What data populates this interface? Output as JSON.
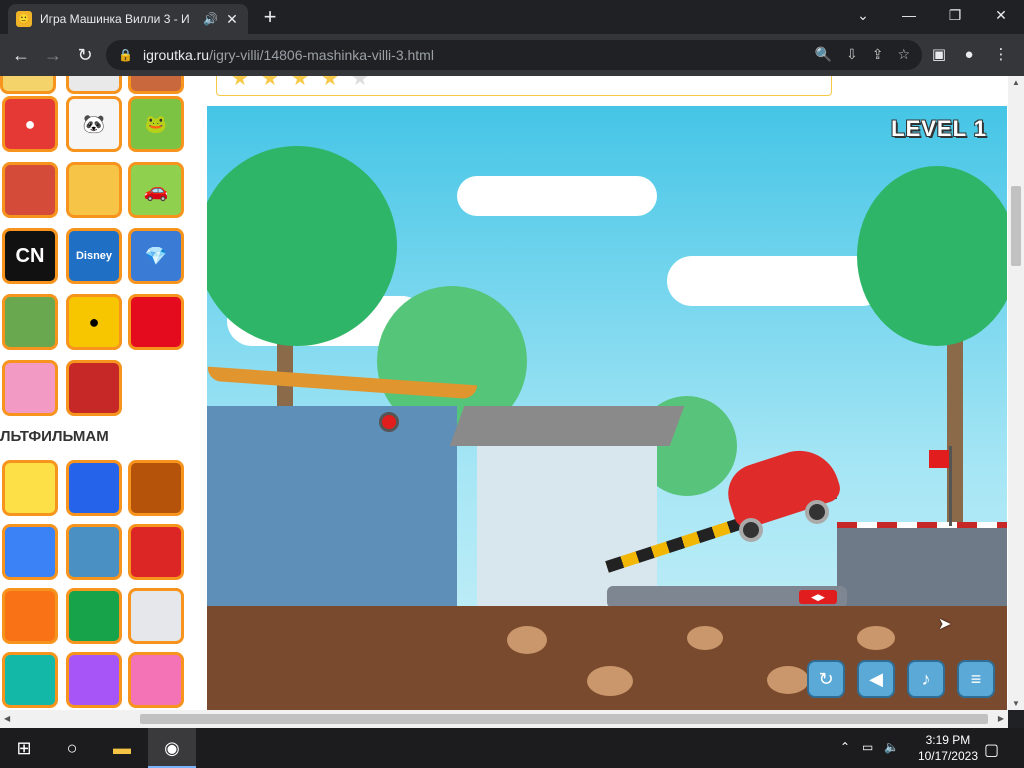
{
  "tab": {
    "title": "Игра Машинка Вилли 3 - И",
    "favicon": "game-favicon",
    "audio_icon": "speaker-icon",
    "close_label": "✕"
  },
  "newtab_label": "+",
  "window": {
    "minimize": "—",
    "maximize": "❐",
    "close": "✕",
    "tabsearch": "⌄"
  },
  "toolbar": {
    "url_host": "igroutka.ru",
    "url_path": "/igry-villi/14806-mashinka-villi-3.html",
    "back": "←",
    "forward": "→",
    "reload": "↻"
  },
  "sidebar": {
    "section_title": "ЛЬТФИЛЬМАМ",
    "thumbs": [
      "angry-birds",
      "panda",
      "cut-the-rope",
      "escape-finger",
      "adam-and-eve",
      "red-car",
      "CN",
      "Disney",
      "jewels",
      "turret",
      "brawl-stars",
      "among-us",
      "pop-it",
      "angry-bird-red",
      "spongebob",
      "sonic",
      "paw-patrol",
      "gravity-falls",
      "tom-and-jerry",
      "cars",
      "naruto",
      "scooby-doo",
      "old-man",
      "perry",
      "equestria-girls",
      "princesses"
    ]
  },
  "game": {
    "level_label": "LEVEL 1",
    "buttons": [
      "restart-icon",
      "sound-icon",
      "music-icon",
      "menu-icon"
    ]
  },
  "taskbar": {
    "time": "3:19 PM",
    "date": "10/17/2023"
  },
  "colors": {
    "accent_orange": "#f7941d",
    "sky": "#45c5e6",
    "car_red": "#e02b2b"
  }
}
